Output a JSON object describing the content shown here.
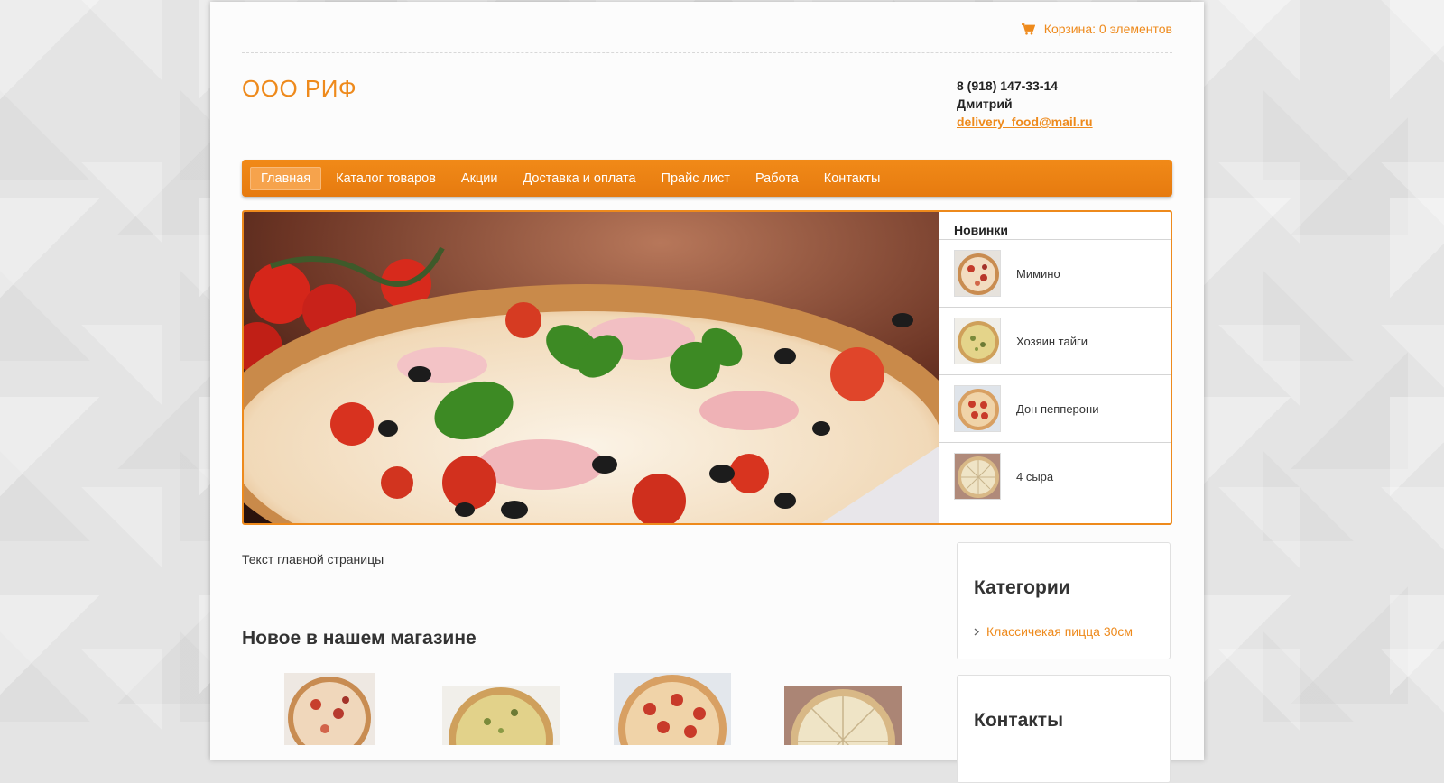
{
  "cart": {
    "label": "Корзина: 0 элементов",
    "icon": "shopping-cart-icon"
  },
  "site": {
    "logo": "ООО РИФ"
  },
  "contacts": {
    "phone": "8 (918) 147-33-14",
    "name": "Дмитрий",
    "email": "delivery_food@mail.ru"
  },
  "nav": {
    "items": [
      "Главная",
      "Каталог товаров",
      "Акции",
      "Доставка и оплата",
      "Прайс лист",
      "Работа",
      "Контакты"
    ],
    "active": "Главная"
  },
  "novelties": {
    "title": "Новинки",
    "items": [
      "Мимино",
      "Хозяин тайги",
      "Дон пепперони",
      "4 сыра"
    ]
  },
  "main": {
    "text": "Текст главной страницы",
    "new_title": "Новое в нашем магазине"
  },
  "sidebar": {
    "categories_title": "Категории",
    "categories": [
      "Классичекая пицца 30см"
    ],
    "contacts_title": "Контакты"
  },
  "colors": {
    "accent": "#ee8a1c"
  }
}
